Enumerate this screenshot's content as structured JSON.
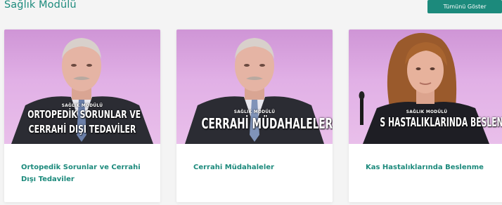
{
  "section": {
    "title": "Sağlık Modülü",
    "show_all_label": "Tümünü Göster"
  },
  "cards": [
    {
      "overlay_small": "SAĞLIK MODÜLÜ",
      "overlay_line1": "ORTOPEDİK SORUNLAR VE",
      "overlay_line2": "CERRAHİ DIŞI TEDAVİLER",
      "title": "Ortopedik Sorunlar ve Cerrahi Dışı Tedaviler"
    },
    {
      "overlay_small": "SAĞLIK MODÜLÜ",
      "overlay_line1": "CERRAHİ MÜDAHALELER",
      "title": "Cerrahi Müdahaleler"
    },
    {
      "overlay_small": "SAĞLIK MODÜLÜ",
      "overlay_line1": "S HASTALIKLARINDA BESLEN",
      "title": "Kas Hastalıklarında Beslenme"
    }
  ],
  "colors": {
    "accent": "#1c8a7c",
    "thumb_background": "#d9a3df",
    "page_background": "#f4f4f4"
  }
}
